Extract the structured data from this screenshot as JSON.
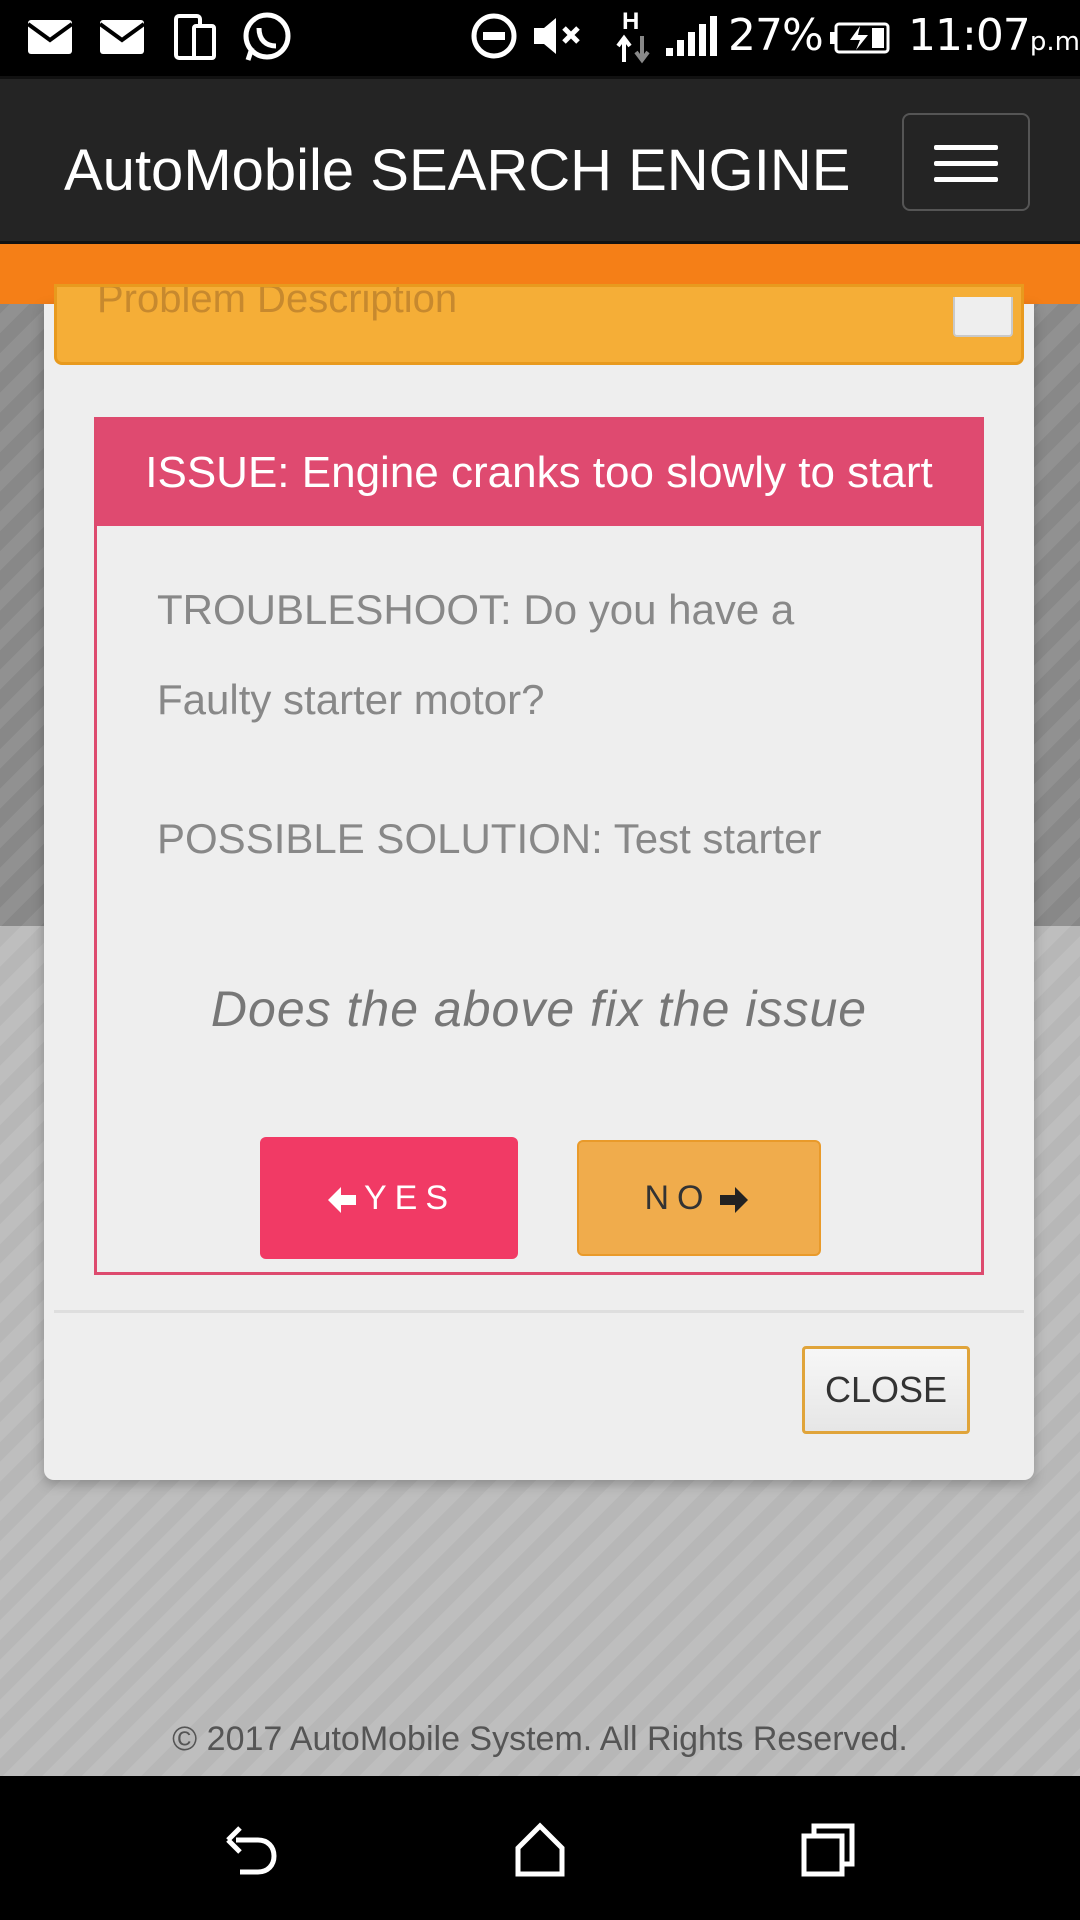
{
  "status_bar": {
    "battery": "27%",
    "time": "11:07",
    "ampm": "p.m.",
    "network": "H"
  },
  "header": {
    "title": "AutoMobile SEARCH ENGINE"
  },
  "form": {
    "problem_placeholder": "Problem Description"
  },
  "modal": {
    "issue": "ISSUE: Engine cranks too slowly to start",
    "troubleshoot": "TROUBLESHOOT: Do you have a Faulty starter motor?",
    "solution": "POSSIBLE SOLUTION: Test starter",
    "question": "Does the above fix the issue",
    "yes_label": "YES",
    "no_label": "NO",
    "close_label": "CLOSE"
  },
  "footer": {
    "copyright": "© 2017 AutoMobile System. All Rights Reserved."
  },
  "colors": {
    "issue_header": "#df4a70",
    "yes_button": "#f13a65",
    "no_button": "#f0ac4c",
    "orange_strip": "#f57f17",
    "navbar": "#242424"
  },
  "icons": {
    "yes_icon": "arrow-left-icon",
    "no_icon": "arrow-right-icon"
  }
}
